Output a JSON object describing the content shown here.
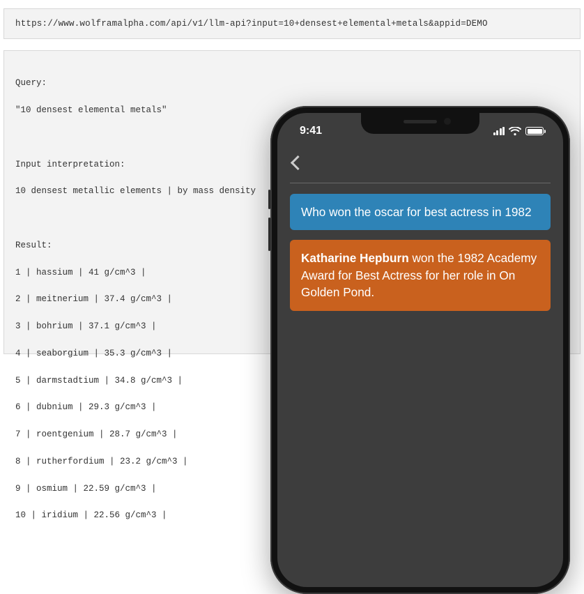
{
  "url_box": {
    "url": "https://www.wolframalpha.com/api/v1/llm-api?input=10+densest+elemental+metals&appid=DEMO"
  },
  "response_box": {
    "query_label": "Query:",
    "query_value": "\"10 densest elemental metals\"",
    "interpretation_label": "Input interpretation:",
    "interpretation_value": "10 densest metallic elements | by mass density",
    "result_label": "Result:",
    "results": [
      "1 | hassium | 41 g/cm^3 |",
      "2 | meitnerium | 37.4 g/cm^3 |",
      "3 | bohrium | 37.1 g/cm^3 |",
      "4 | seaborgium | 35.3 g/cm^3 |",
      "5 | darmstadtium | 34.8 g/cm^3 |",
      "6 | dubnium | 29.3 g/cm^3 |",
      "7 | roentgenium | 28.7 g/cm^3 |",
      "8 | rutherfordium | 23.2 g/cm^3 |",
      "9 | osmium | 22.59 g/cm^3 |",
      "10 | iridium | 22.56 g/cm^3 |"
    ]
  },
  "phone": {
    "status_bar": {
      "time": "9:41"
    },
    "chat": {
      "user_message": "Who won the oscar for best actress in 1982",
      "assistant_bold": "Katharine Hepburn",
      "assistant_rest": " won the 1982 Academy Award for Best Actress for her role in On Golden Pond."
    }
  }
}
